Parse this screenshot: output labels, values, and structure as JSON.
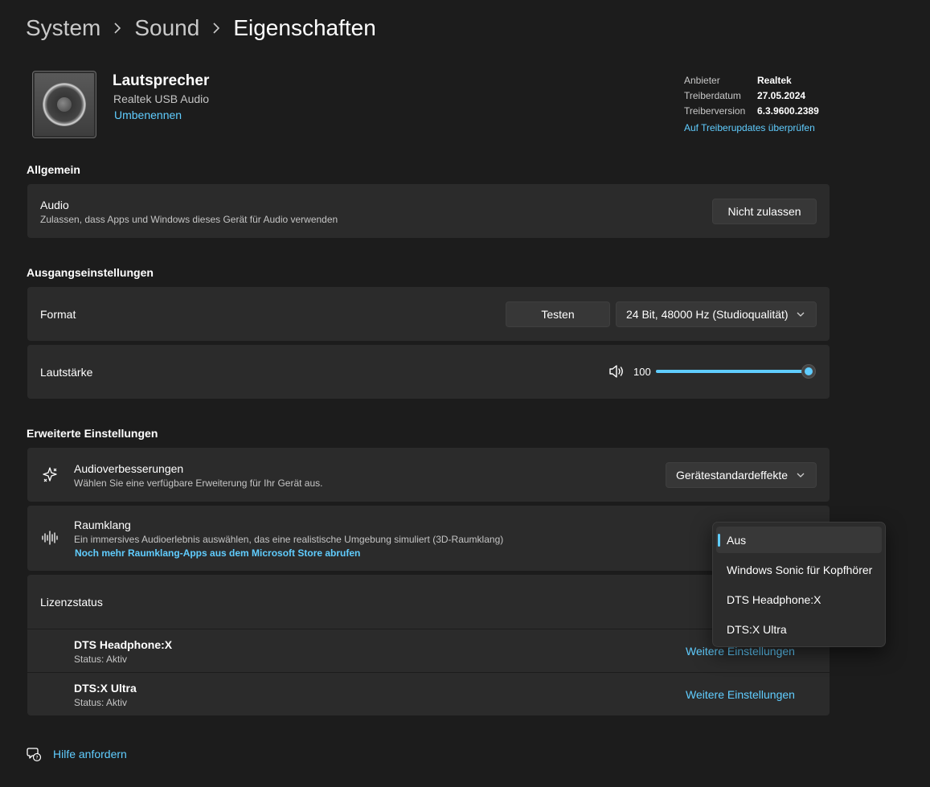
{
  "breadcrumb": {
    "items": [
      "System",
      "Sound",
      "Eigenschaften"
    ]
  },
  "device": {
    "name": "Lautsprecher",
    "subtitle": "Realtek USB Audio",
    "rename_link": "Umbenennen",
    "driver": {
      "provider_label": "Anbieter",
      "provider_value": "Realtek",
      "date_label": "Treiberdatum",
      "date_value": "27.05.2024",
      "version_label": "Treiberversion",
      "version_value": "6.3.9600.2389",
      "update_link": "Auf Treiberupdates überprüfen"
    }
  },
  "general": {
    "section_title": "Allgemein",
    "audio": {
      "title": "Audio",
      "description": "Zulassen, dass Apps und Windows dieses Gerät für Audio verwenden",
      "button": "Nicht zulassen"
    }
  },
  "output": {
    "section_title": "Ausgangseinstellungen",
    "format": {
      "title": "Format",
      "test_button": "Testen",
      "selected": "24 Bit, 48000 Hz (Studioqualität)"
    },
    "volume": {
      "title": "Lautstärke",
      "value": "100",
      "level_percent": 100
    }
  },
  "advanced": {
    "section_title": "Erweiterte Einstellungen",
    "enhancements": {
      "title": "Audioverbesserungen",
      "description": "Wählen Sie eine verfügbare Erweiterung für Ihr Gerät aus.",
      "selected": "Gerätestandardeffekte",
      "icon": "sparkle-enhance-icon"
    },
    "spatial": {
      "title": "Raumklang",
      "description": "Ein immersives Audioerlebnis auswählen, das eine realistische Umgebung simuliert (3D-Raumklang)",
      "store_link": "Noch mehr Raumklang-Apps aus dem Microsoft Store abrufen",
      "icon": "waveform-icon",
      "dropdown_options": [
        "Aus",
        "Windows Sonic für Kopfhörer",
        "DTS Headphone:X",
        "DTS:X Ultra"
      ],
      "dropdown_selected": "Aus"
    },
    "license": {
      "title": "Lizenzstatus",
      "items": [
        {
          "name": "DTS Headphone:X",
          "status": "Status: Aktiv",
          "link": "Weitere Einstellungen"
        },
        {
          "name": "DTS:X Ultra",
          "status": "Status: Aktiv",
          "link": "Weitere Einstellungen"
        }
      ]
    }
  },
  "help": {
    "label": "Hilfe anfordern",
    "icon": "help-chat-icon"
  },
  "colors": {
    "accent": "#60cdff",
    "background": "#1c1c1c",
    "card": "#2b2b2b"
  }
}
